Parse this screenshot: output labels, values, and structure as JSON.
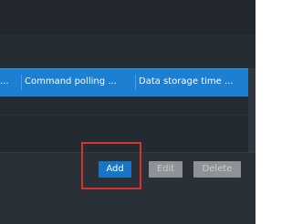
{
  "table": {
    "columns": [
      {
        "label": "..."
      },
      {
        "label": "Command polling ..."
      },
      {
        "label": "Data storage time ..."
      }
    ]
  },
  "toolbar": {
    "add_label": "Add",
    "edit_label": "Edit",
    "delete_label": "Delete"
  },
  "annotation": {
    "highlight_color": "#d8322f"
  },
  "colors": {
    "header_accent": "#1c7fd1",
    "primary_button": "#1576c8",
    "disabled_button": "#8e9296",
    "background": "#232931"
  }
}
